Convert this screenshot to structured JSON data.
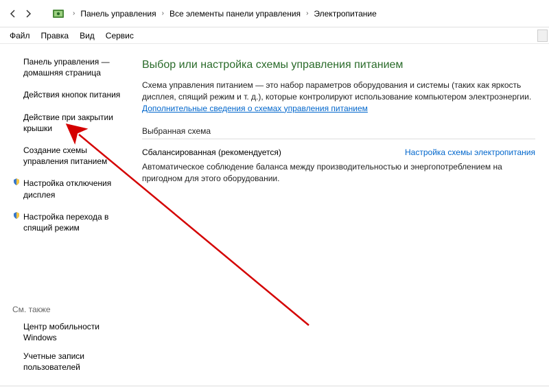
{
  "breadcrumb": {
    "items": [
      "Панель управления",
      "Все элементы панели управления",
      "Электропитание"
    ]
  },
  "menu": {
    "items": [
      "Файл",
      "Правка",
      "Вид",
      "Сервис"
    ]
  },
  "sidebar": {
    "home": "Панель управления — домашняя страница",
    "links": [
      {
        "label": "Действия кнопок питания",
        "bullet": false
      },
      {
        "label": "Действие при закрытии крышки",
        "bullet": false
      },
      {
        "label": "Создание схемы управления питанием",
        "bullet": false
      },
      {
        "label": "Настройка отключения дисплея",
        "bullet": true
      },
      {
        "label": "Настройка перехода в спящий режим",
        "bullet": true
      }
    ],
    "see_also_header": "См. также",
    "see_also": [
      "Центр мобильности Windows",
      "Учетные записи пользователей"
    ]
  },
  "main": {
    "heading": "Выбор или настройка схемы управления питанием",
    "description": "Схема управления питанием — это набор параметров оборудования и системы (таких как яркость дисплея, спящий режим и т. д.), которые контролируют использование компьютером электроэнергии.",
    "more_link": "Дополнительные сведения о схемах управления питанием",
    "section_header": "Выбранная схема",
    "plan_name": "Сбалансированная (рекомендуется)",
    "plan_settings_link": "Настройка схемы электропитания",
    "plan_desc": "Автоматическое соблюдение баланса между производительностью и энергопотреблением на пригодном для этого оборудовании."
  }
}
